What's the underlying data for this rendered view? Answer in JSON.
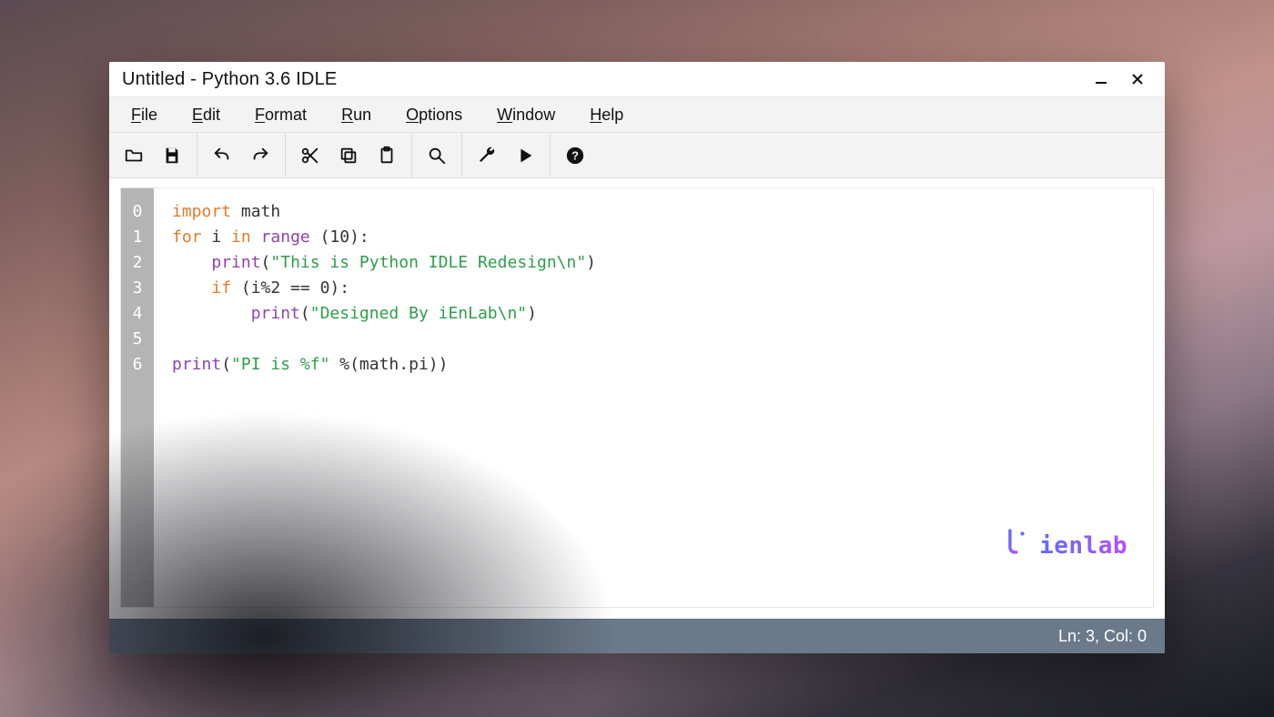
{
  "window": {
    "title": "Untitled - Python 3.6 IDLE"
  },
  "menu": {
    "items": [
      {
        "hot": "F",
        "rest": "ile"
      },
      {
        "hot": "E",
        "rest": "dit"
      },
      {
        "hot": "F",
        "rest": "ormat"
      },
      {
        "hot": "R",
        "rest": "un"
      },
      {
        "hot": "O",
        "rest": "ptions"
      },
      {
        "hot": "W",
        "rest": "indow"
      },
      {
        "hot": "H",
        "rest": "elp"
      }
    ]
  },
  "toolbar": {
    "icons": [
      "folder",
      "save",
      "undo",
      "redo",
      "cut",
      "copy",
      "paste",
      "search",
      "wrench",
      "play",
      "help"
    ]
  },
  "code": {
    "lines": [
      "0",
      "1",
      "2",
      "3",
      "4",
      "5",
      "6"
    ],
    "l0_kw": "import",
    "l0_rest": " math",
    "l1_kw1": "for",
    "l1_mid": " i ",
    "l1_kw2": "in",
    "l1_sp": " ",
    "l1_fn": "range",
    "l1_tail": " (10):",
    "l2_indent": "    ",
    "l2_fn": "print",
    "l2_open": "(",
    "l2_str": "\"This is Python IDLE Redesign\\n\"",
    "l2_close": ")",
    "l3_indent": "    ",
    "l3_kw": "if",
    "l3_tail": " (i%2 == 0):",
    "l4_indent": "        ",
    "l4_fn": "print",
    "l4_open": "(",
    "l4_str": "\"Designed By iEnLab\\n\"",
    "l4_close": ")",
    "l5": "",
    "l6_fn": "print",
    "l6_open": "(",
    "l6_str": "\"PI is %f\"",
    "l6_mid": " %(math.pi))"
  },
  "watermark": {
    "text": "ienlab"
  },
  "status": {
    "text": "Ln: 3, Col: 0"
  }
}
